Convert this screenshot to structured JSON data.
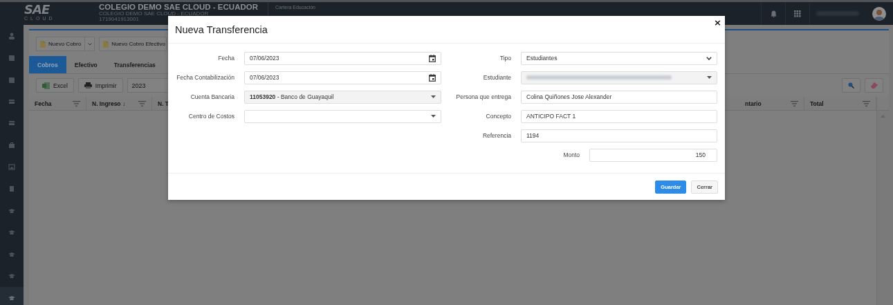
{
  "header": {
    "logo": "SAE",
    "logo_sub": "CLOUD",
    "school": "COLEGIO DEMO SAE CLOUD - ECUADOR",
    "school_subtitle": "COLEGIO DEMO SAE CLOUD - ECUADOR",
    "ruc": "1719041913001",
    "module": "Cartera Educación"
  },
  "sidebar": {
    "items": [
      {
        "kind": "person",
        "selected": false
      },
      {
        "kind": "book",
        "selected": false
      },
      {
        "kind": "book",
        "selected": false
      },
      {
        "kind": "card",
        "selected": false
      },
      {
        "kind": "card",
        "selected": false
      },
      {
        "kind": "briefcase",
        "selected": false
      },
      {
        "kind": "frame",
        "selected": false
      },
      {
        "kind": "document",
        "selected": false
      },
      {
        "kind": "cap",
        "selected": false
      },
      {
        "kind": "cap",
        "selected": false
      },
      {
        "kind": "cap",
        "selected": false
      },
      {
        "kind": "cap",
        "selected": false
      },
      {
        "kind": "cap",
        "selected": true
      }
    ]
  },
  "actions": [
    {
      "label": "Nuevo Cobro",
      "menu": true
    },
    {
      "label": "Nuevo Cobro Efectivo",
      "menu": false
    }
  ],
  "tabs": [
    {
      "label": "Cobros",
      "selected": true
    },
    {
      "label": "Efectivo",
      "selected": false
    },
    {
      "label": "Transferencias",
      "selected": false
    }
  ],
  "table_toolbar": {
    "buttons": [
      {
        "label": "Excel",
        "kind": "excel"
      },
      {
        "label": "Imprimir",
        "kind": "printer"
      }
    ],
    "year": "2023"
  },
  "table": {
    "columns": [
      {
        "label": "Fecha",
        "filter": true
      },
      {
        "label": "N. Ingreso ↓",
        "filter": true
      },
      {
        "label": "N. T",
        "filter": false
      },
      {
        "label": "ntario",
        "filter": true
      },
      {
        "label": "Total",
        "filter": true
      }
    ]
  },
  "modal": {
    "title": "Nueva Transferencia",
    "close": "×",
    "left_fields": [
      {
        "label": "Fecha",
        "kind": "date",
        "value": "07/06/2023"
      },
      {
        "label": "Fecha Contabilización",
        "kind": "date",
        "value": "07/06/2023"
      },
      {
        "label": "Cuenta Bancaria",
        "kind": "select",
        "value": "**11053920** - Banco de Guayaquil",
        "disabled": true
      },
      {
        "label": "Centro de Costos",
        "kind": "select",
        "disabled": false
      }
    ],
    "right_fields": [
      {
        "label": "Tipo",
        "kind": "dropdown",
        "value": "Estudiantes"
      },
      {
        "label": "Estudiante",
        "kind": "select",
        "redacted": true,
        "disabled": true
      },
      {
        "label": "Persona que entrega",
        "kind": "text",
        "value": "Colina Quiñones Jose Alexander"
      },
      {
        "label": "Concepto",
        "kind": "text",
        "value": "ANTICIPO FACT 1"
      },
      {
        "label": "Referencia",
        "kind": "text",
        "value": "1194"
      },
      {
        "label": "Monto",
        "kind": "amount",
        "value": "150"
      }
    ],
    "buttons": [
      {
        "label": "Guardar",
        "primary": true
      },
      {
        "label": "Cerrar",
        "primary": false
      }
    ]
  }
}
